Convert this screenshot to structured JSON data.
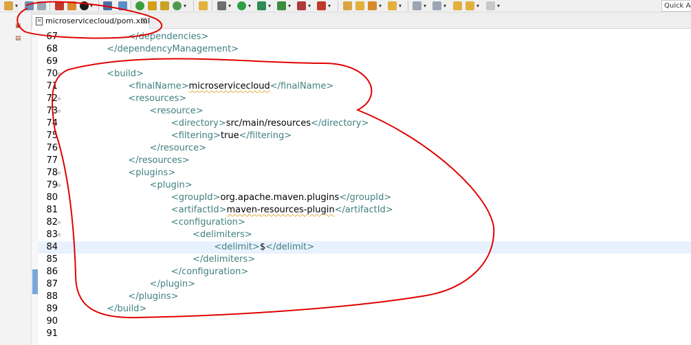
{
  "toolbar": {
    "quick_access": "Quick Ac",
    "icons": [
      "new-icon",
      "save-icon",
      "print-icon",
      "run-icon",
      "debug-icon",
      "search-icon",
      "refresh-icon",
      "package-icon",
      "external-tools-icon",
      "forward-icon",
      "back-icon"
    ]
  },
  "tab": {
    "label": "microservicecloud/pom.xml",
    "close": "☒",
    "file_icon": "xml-file-icon"
  },
  "editor": {
    "current_line": 84,
    "lines": [
      {
        "n": "67",
        "fold": false,
        "indent": 2,
        "parts": [
          [
            "tag",
            "</dependencies>"
          ]
        ]
      },
      {
        "n": "68",
        "fold": false,
        "indent": 1,
        "parts": [
          [
            "tag",
            "</dependencyManagement>"
          ]
        ]
      },
      {
        "n": "69",
        "fold": false,
        "indent": 0,
        "parts": []
      },
      {
        "n": "70",
        "fold": true,
        "indent": 1,
        "parts": [
          [
            "tag",
            "<build>"
          ]
        ]
      },
      {
        "n": "71",
        "fold": false,
        "indent": 2,
        "parts": [
          [
            "tag",
            "<finalName>"
          ],
          [
            "sq",
            "microservicecloud"
          ],
          [
            "tag",
            "</finalName>"
          ]
        ]
      },
      {
        "n": "72",
        "fold": true,
        "indent": 2,
        "parts": [
          [
            "tag",
            "<resources>"
          ]
        ]
      },
      {
        "n": "73",
        "fold": true,
        "indent": 3,
        "parts": [
          [
            "tag",
            "<resource>"
          ]
        ]
      },
      {
        "n": "74",
        "fold": false,
        "indent": 4,
        "parts": [
          [
            "tag",
            "<directory>"
          ],
          [
            "txt",
            "src/main/resources"
          ],
          [
            "tag",
            "</directory>"
          ]
        ]
      },
      {
        "n": "75",
        "fold": false,
        "indent": 4,
        "parts": [
          [
            "tag",
            "<filtering>"
          ],
          [
            "txt",
            "true"
          ],
          [
            "tag",
            "</filtering>"
          ]
        ]
      },
      {
        "n": "76",
        "fold": false,
        "indent": 3,
        "parts": [
          [
            "tag",
            "</resource>"
          ]
        ]
      },
      {
        "n": "77",
        "fold": false,
        "indent": 2,
        "parts": [
          [
            "tag",
            "</resources>"
          ]
        ]
      },
      {
        "n": "78",
        "fold": true,
        "indent": 2,
        "parts": [
          [
            "tag",
            "<plugins>"
          ]
        ]
      },
      {
        "n": "79",
        "fold": true,
        "indent": 3,
        "parts": [
          [
            "tag",
            "<plugin>"
          ]
        ]
      },
      {
        "n": "80",
        "fold": false,
        "indent": 4,
        "parts": [
          [
            "tag",
            "<groupId>"
          ],
          [
            "txt",
            "org.apache.maven.plugins"
          ],
          [
            "tag",
            "</groupId>"
          ]
        ]
      },
      {
        "n": "81",
        "fold": false,
        "indent": 4,
        "parts": [
          [
            "tag",
            "<artifactId>"
          ],
          [
            "sq",
            "maven-resources-plugin"
          ],
          [
            "tag",
            "</artifactId>"
          ]
        ]
      },
      {
        "n": "82",
        "fold": true,
        "indent": 4,
        "parts": [
          [
            "tag",
            "<configuration>"
          ]
        ]
      },
      {
        "n": "83",
        "fold": true,
        "indent": 5,
        "parts": [
          [
            "tag",
            "<delimiters>"
          ]
        ]
      },
      {
        "n": "84",
        "fold": false,
        "indent": 6,
        "parts": [
          [
            "tag",
            "<delimit>"
          ],
          [
            "txt",
            "$"
          ],
          [
            "tag",
            "</delimit>"
          ]
        ]
      },
      {
        "n": "85",
        "fold": false,
        "indent": 5,
        "parts": [
          [
            "tag",
            "</delimiters>"
          ]
        ]
      },
      {
        "n": "86",
        "fold": false,
        "indent": 4,
        "parts": [
          [
            "tag",
            "</configuration>"
          ]
        ]
      },
      {
        "n": "87",
        "fold": false,
        "indent": 3,
        "parts": [
          [
            "tag",
            "</plugin>"
          ]
        ]
      },
      {
        "n": "88",
        "fold": false,
        "indent": 2,
        "parts": [
          [
            "tag",
            "</plugins>"
          ]
        ]
      },
      {
        "n": "89",
        "fold": false,
        "indent": 1,
        "parts": [
          [
            "tag",
            "</build>"
          ]
        ]
      },
      {
        "n": "90",
        "fold": false,
        "indent": 0,
        "parts": []
      },
      {
        "n": "91",
        "fold": false,
        "indent": 0,
        "parts": []
      }
    ]
  },
  "colors": {
    "tag": "#3f7f7f",
    "text": "#000000",
    "line_number": "#787878",
    "current_line": "#e8f2fe",
    "annotation": "#e00000"
  }
}
